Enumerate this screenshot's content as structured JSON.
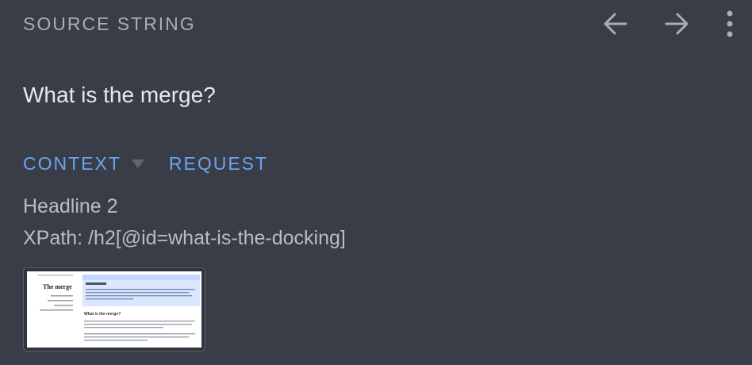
{
  "header": {
    "title": "SOURCE STRING",
    "icons": [
      "arrow-left-icon",
      "arrow-right-icon",
      "more-vertical-icon"
    ]
  },
  "source": {
    "text": "What is the merge?"
  },
  "tabs": {
    "context_label": "CONTEXT",
    "request_label": "REQUEST",
    "context_caret_icon": "caret-down-icon"
  },
  "context": {
    "element_type": "Headline 2",
    "xpath": "XPath: /h2[@id=what-is-the-docking]"
  },
  "screenshot_thumbnail": {
    "page_title": "The merge",
    "heading": "What is the merge?"
  },
  "colors": {
    "background": "#393d47",
    "header_text": "#a9adb6",
    "source_text": "#e6e8ec",
    "accent": "#6ea4ee",
    "context_text": "#b8bcc5",
    "icon": "#a9adb6"
  }
}
